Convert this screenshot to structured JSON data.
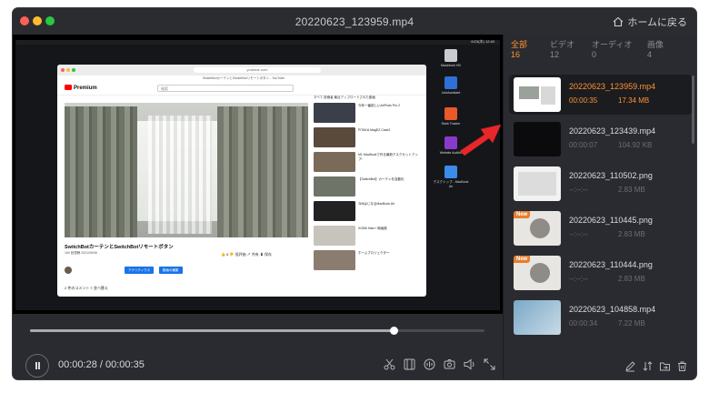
{
  "window": {
    "title": "20220623_123959.mp4",
    "home_label": "ホームに戻る"
  },
  "screen": {
    "menubar_time": "6/23(木) 12:40",
    "browser": {
      "url": "youtube.com",
      "tab": "SwitchBotカーテンとSwitchBotリモートボタン - YouTube",
      "logo": "Premium",
      "search_placeholder": "検索",
      "video_title": "SwitchBotカーテンとSwitchBotリモートボタン",
      "video_meta": "184 回視聴 2021/06/06",
      "actions": "👍 8   👎 低評価   ↗ 共有   ⬇ 保存",
      "channel_buttons": [
        "アナリティクス",
        "動画の編集"
      ],
      "comment_count": "2 件のコメント    ≡ 並べ替え",
      "chips": "すべて   投稿者   最近アップロードされた動画",
      "recommend": [
        "今年一番欲しいAirPods Pro 2",
        "PITAKA MagEZ Case2",
        "M1 MacBookで作る最新デスクセットアップ!",
        "【SwitchBot】カーテンを自動化",
        "今MはじなるMacBook Air",
        "XGIMI Halo+ 映画館",
        "ホームプロジェクター"
      ]
    },
    "desktop_icons": [
      "Macintosh HD",
      "LinkAssistant",
      "Rank Tracker",
      "Website Auditor",
      "デスクトップ - MacBook Air"
    ]
  },
  "player": {
    "current_time": "00:00:28",
    "duration": "00:00:35",
    "separator": "/",
    "progress": 0.8
  },
  "tools": [
    "scissors-icon",
    "film-icon",
    "audio-icon",
    "camera-icon",
    "volume-icon",
    "expand-icon"
  ],
  "tabs": [
    {
      "label": "全部",
      "count": "16"
    },
    {
      "label": "ビデオ",
      "count": "12"
    },
    {
      "label": "オーディオ",
      "count": "0"
    },
    {
      "label": "画像",
      "count": "4"
    }
  ],
  "files": [
    {
      "name": "20220623_123959.mp4",
      "duration": "00:00:35",
      "size": "17.34 MB",
      "selected": true,
      "new": false
    },
    {
      "name": "20220623_123439.mp4",
      "duration": "00:00:07",
      "size": "104.92 KB",
      "selected": false,
      "new": false
    },
    {
      "name": "20220623_110502.png",
      "duration": "--:--:--",
      "size": "2.83 MB",
      "selected": false,
      "new": false
    },
    {
      "name": "20220623_110445.png",
      "duration": "--:--:--",
      "size": "2.83 MB",
      "selected": false,
      "new": true
    },
    {
      "name": "20220623_110444.png",
      "duration": "--:--:--",
      "size": "2.83 MB",
      "selected": false,
      "new": true
    },
    {
      "name": "20220623_104858.mp4",
      "duration": "00:00:34",
      "size": "7.22 MB",
      "selected": false,
      "new": false
    }
  ],
  "new_badge": "New",
  "colors": {
    "accent": "#ff9330",
    "arrow": "#e8272a",
    "panel": "#2a2b30"
  }
}
